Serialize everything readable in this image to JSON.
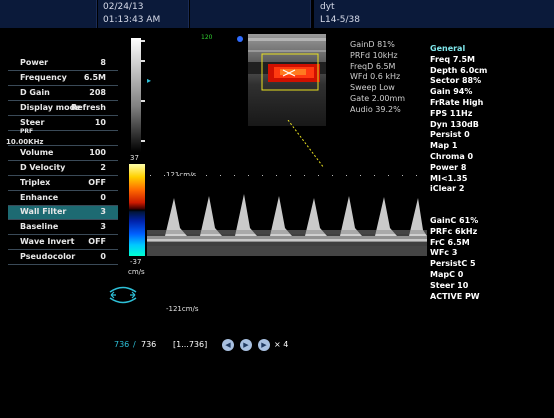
{
  "header": {
    "date": "02/24/13",
    "time": "01:13:43 AM",
    "user": "dyt",
    "probe": "L14-5/38"
  },
  "left_panel": {
    "items": [
      {
        "label": "Power",
        "value": "8"
      },
      {
        "label": "Frequency",
        "value": "6.5M"
      },
      {
        "label": "D Gain",
        "value": "208"
      },
      {
        "label": "Display mode",
        "value": "Refresh"
      },
      {
        "label": "Steer",
        "value": "10"
      },
      {
        "label": "PRF",
        "value": ""
      },
      {
        "label": "Volume",
        "value": "100"
      },
      {
        "label": "D Velocity",
        "value": "2"
      },
      {
        "label": "Triplex",
        "value": "OFF"
      },
      {
        "label": "Enhance",
        "value": "0"
      },
      {
        "label": "Wall Filter",
        "value": "3"
      },
      {
        "label": "Baseline",
        "value": "3"
      },
      {
        "label": "Wave Invert",
        "value": "OFF"
      },
      {
        "label": "Pseudocolor",
        "value": "0"
      }
    ],
    "prf_value": "10.00KHz",
    "active_index": 10
  },
  "depth_marker": "120",
  "colorbar": {
    "top_label": "37",
    "bottom_label": "-37",
    "unit": "cm/s"
  },
  "doppler_params": [
    "GainD 81%",
    "PRFd 10kHz",
    "FreqD 6.5M",
    "WFd 0.6 kHz",
    "Sweep Low",
    "Gate 2.00mm",
    "Audio 39.2%"
  ],
  "general_title": "General",
  "general_params": [
    "Freq 7.5M",
    "Depth 6.0cm",
    "Sector 88%",
    "Gain 94%",
    "FrRate High",
    "FPS 11Hz",
    "Dyn 130dB",
    "Persist 0",
    "Map 1",
    "Chroma 0",
    "Power 8",
    "MI<1.35",
    "iClear 2"
  ],
  "color_params": [
    "GainC 61%",
    "PRFc 6kHz",
    "FrC 6.5M",
    "WFc 3",
    "PersistC 5",
    "MapC 0",
    "Steer 10",
    "ACTIVE PW"
  ],
  "scale": {
    "top": "121cm/s",
    "bottom": "-121cm/s"
  },
  "footer": {
    "frame_current": "736",
    "separator": "/",
    "frame_total": "736",
    "range": "[1...736]",
    "speed": "× 4"
  },
  "colors": {
    "accent": "#2ec0d8",
    "general": "#7fe6ea",
    "header_bg": "#0b1a3a",
    "active_row": "#1d6a72"
  }
}
